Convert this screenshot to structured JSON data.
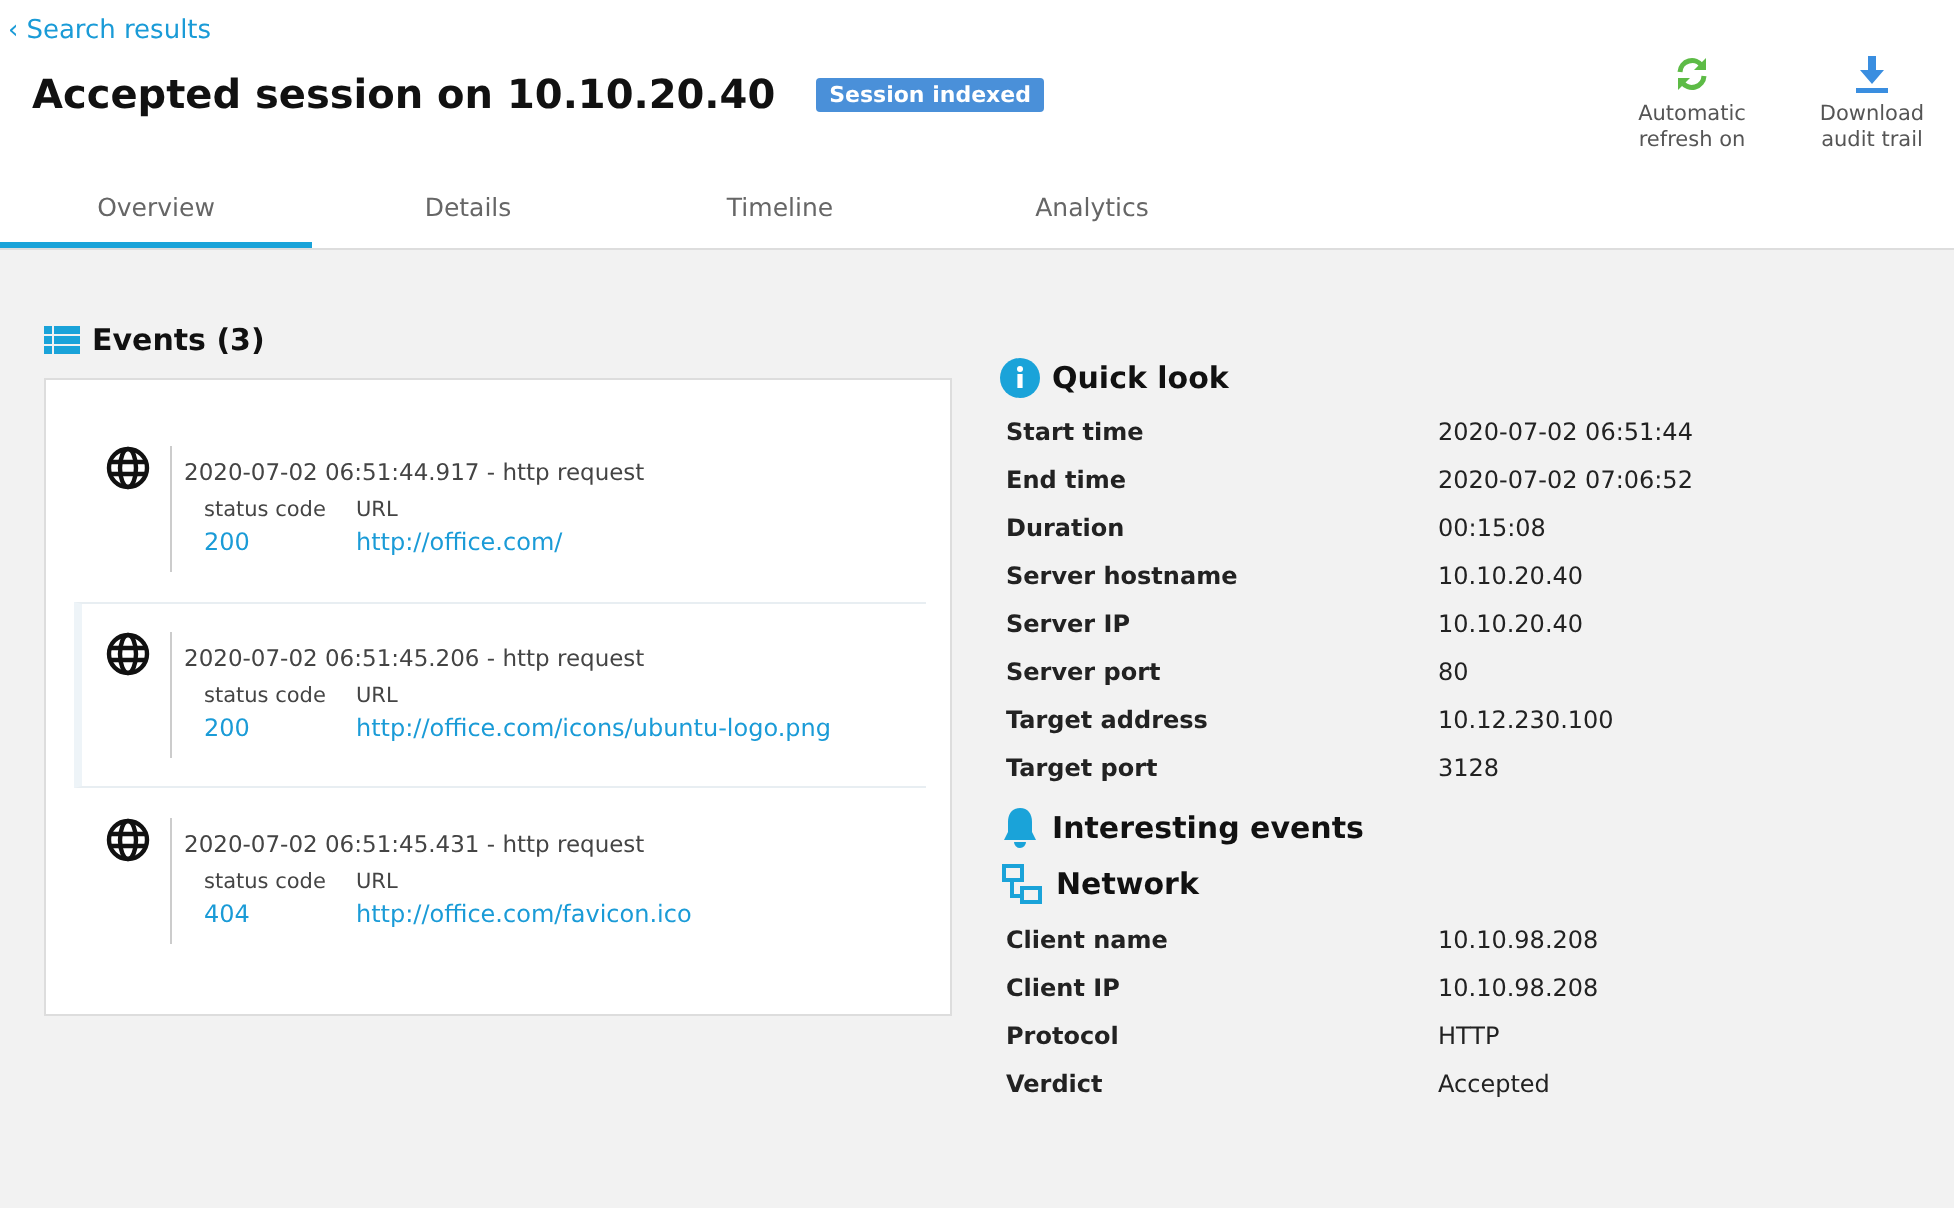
{
  "back_link": {
    "icon": "‹",
    "label": "Search results"
  },
  "title": "Accepted session on 10.10.20.40",
  "badge": "Session indexed",
  "actions": [
    {
      "kind": "refresh",
      "label": "Automatic refresh on"
    },
    {
      "kind": "download",
      "label": "Download audit trail"
    }
  ],
  "tabs": [
    {
      "label": "Overview",
      "selected": true
    },
    {
      "label": "Details",
      "selected": false
    },
    {
      "label": "Timeline",
      "selected": false
    },
    {
      "label": "Analytics",
      "selected": false
    }
  ],
  "events": {
    "title": "Events (3)",
    "items": [
      {
        "heading": "2020-07-02 06:51:44.917 - http request",
        "status_label": "status code",
        "status": "200",
        "url_label": "URL",
        "url": "http://office.com/",
        "highlighted": false
      },
      {
        "heading": "2020-07-02 06:51:45.206 - http request",
        "status_label": "status code",
        "status": "200",
        "url_label": "URL",
        "url": "http://office.com/icons/ubuntu-logo.png",
        "highlighted": true
      },
      {
        "heading": "2020-07-02 06:51:45.431 - http request",
        "status_label": "status code",
        "status": "404",
        "url_label": "URL",
        "url": "http://office.com/favicon.ico",
        "highlighted": false
      }
    ]
  },
  "sections": [
    {
      "kind": "info",
      "title": "Quick look",
      "rows": [
        {
          "label": "Start time",
          "value": "2020-07-02 06:51:44"
        },
        {
          "label": "End time",
          "value": "2020-07-02 07:06:52"
        },
        {
          "label": "Duration",
          "value": "00:15:08"
        },
        {
          "label": "Server hostname",
          "value": "10.10.20.40"
        },
        {
          "label": "Server IP",
          "value": "10.10.20.40"
        },
        {
          "label": "Server port",
          "value": "80"
        },
        {
          "label": "Target address",
          "value": "10.12.230.100"
        },
        {
          "label": "Target port",
          "value": "3128"
        }
      ]
    },
    {
      "kind": "bell",
      "title": "Interesting events"
    },
    {
      "kind": "network",
      "title": "Network",
      "rows": [
        {
          "label": "Client name",
          "value": "10.10.98.208"
        },
        {
          "label": "Client IP",
          "value": "10.10.98.208"
        },
        {
          "label": "Protocol",
          "value": "HTTP"
        },
        {
          "label": "Verdict",
          "value": "Accepted"
        }
      ]
    }
  ]
}
